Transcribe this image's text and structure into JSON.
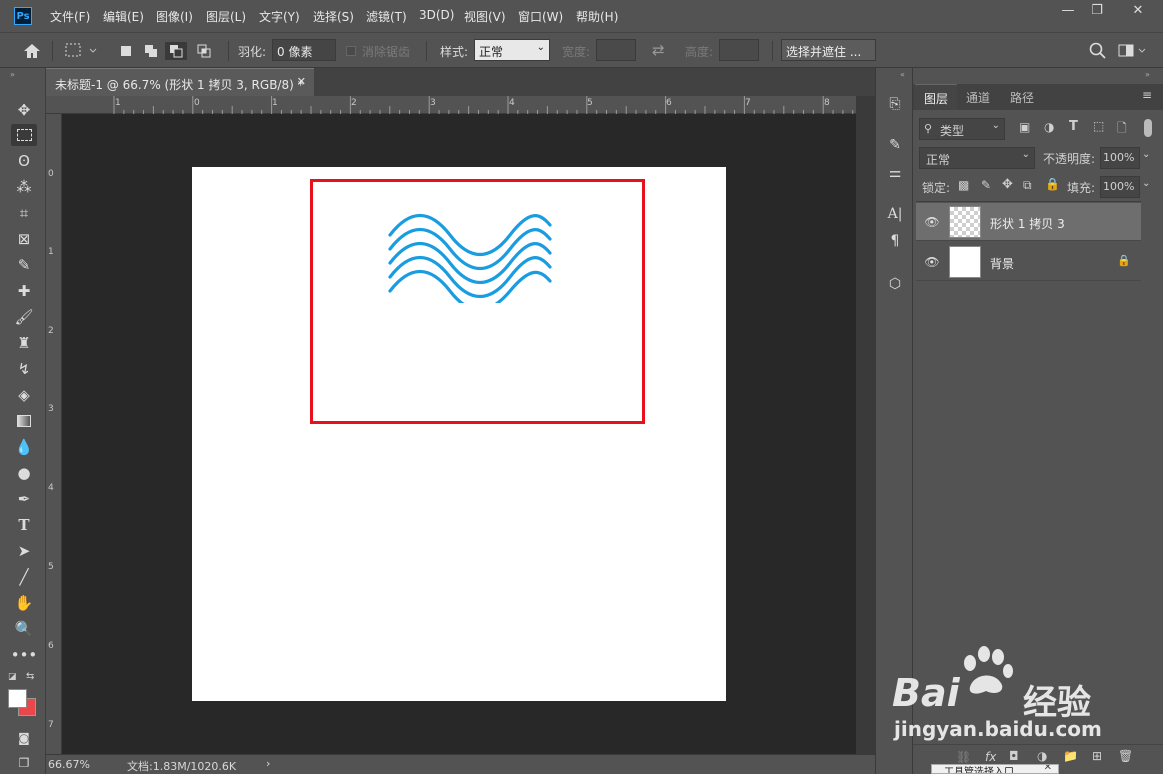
{
  "app": {
    "logo": "Ps",
    "name": "Photoshop"
  },
  "menu": [
    "文件(F)",
    "编辑(E)",
    "图像(I)",
    "图层(L)",
    "文字(Y)",
    "选择(S)",
    "滤镜(T)",
    "3D(D)",
    "视图(V)",
    "窗口(W)",
    "帮助(H)"
  ],
  "window_controls": {
    "minimize": "—",
    "restore": "❐",
    "close": "✕"
  },
  "options": {
    "feather_label": "羽化:",
    "feather_value": "0 像素",
    "antialias_label": "消除锯齿",
    "style_label": "样式:",
    "style_value": "正常",
    "width_label": "宽度:",
    "height_label": "高度:",
    "select_mask_label": "选择并遮住 ..."
  },
  "document": {
    "tab_title": "未标题-1 @ 66.7% (形状 1 拷贝 3, RGB/8) *",
    "zoom": "66.67%",
    "doc_info": "文档:1.83M/1020.6K"
  },
  "ruler_top": [
    "1",
    "0",
    "1",
    "2",
    "3",
    "4",
    "5",
    "6",
    "7",
    "8"
  ],
  "ruler_left": [
    "0",
    "1",
    "2",
    "3",
    "4",
    "5",
    "6",
    "7"
  ],
  "layers_panel": {
    "tabs": [
      "图层",
      "通道",
      "路径"
    ],
    "filter_label": "类型",
    "blend_mode": "正常",
    "opacity_label": "不透明度:",
    "opacity_value": "100%",
    "lock_label": "锁定:",
    "fill_label": "填充:",
    "fill_value": "100%",
    "layers": [
      {
        "name": "形状 1 拷贝 3",
        "selected": true
      },
      {
        "name": "背景",
        "selected": false
      }
    ],
    "bottom_popup": "工具管选择入口"
  },
  "colors": {
    "wave": "#1a9de0",
    "highlight_box": "#e8101a",
    "foreground": "#ffffff",
    "background": "#e8474b"
  },
  "watermark": {
    "brand": "Bai",
    "brand2": "经验",
    "url": "jingyan.baidu.com"
  }
}
